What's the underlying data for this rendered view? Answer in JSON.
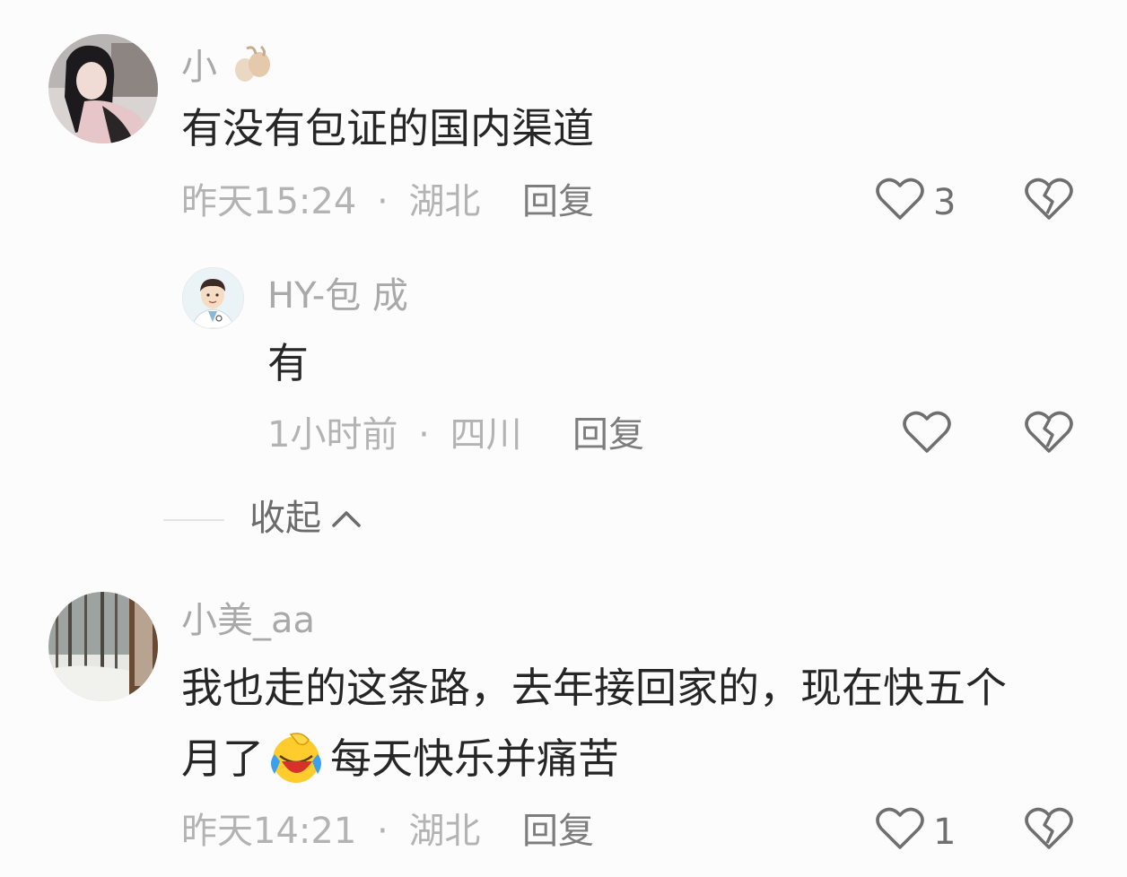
{
  "comments": [
    {
      "username": "小",
      "text": "有没有包证的国内渠道",
      "time": "昨天15:24",
      "location": "湖北",
      "reply_label": "回复",
      "likes": "3",
      "replies": [
        {
          "username": "HY-包 成",
          "text": "有",
          "time": "1小时前",
          "location": "四川",
          "reply_label": "回复"
        }
      ]
    },
    {
      "username": "小美_aa",
      "text_line1": "我也走的这条路，去年接回家的，现在快五个",
      "text_line2_a": "月了",
      "text_line2_b": "每天快乐并痛苦",
      "time": "昨天14:21",
      "location": "湖北",
      "reply_label": "回复",
      "likes": "1"
    }
  ],
  "separator": "·",
  "collapse_label": "收起",
  "icons": {
    "like": "heart-outline-icon",
    "dislike": "broken-heart-icon",
    "collapse": "chevron-up-icon",
    "emoji": "laughing-crying-emoji-icon"
  }
}
